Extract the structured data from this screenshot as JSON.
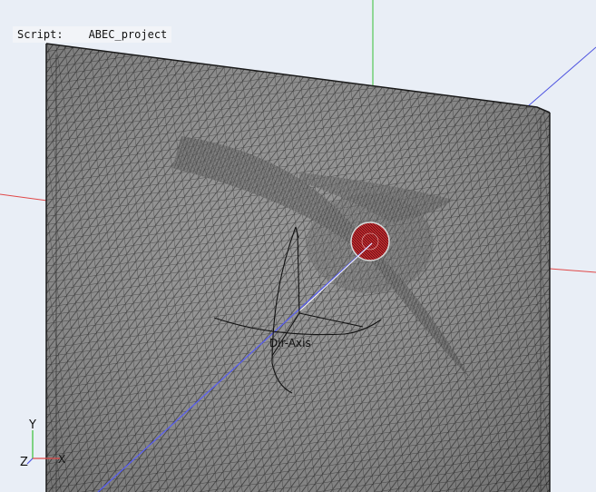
{
  "script": {
    "label": "Script:",
    "value": "ABEC_project"
  },
  "origin_axes": {
    "x": "X",
    "y": "Y",
    "z": "Z"
  },
  "triad_caption": "Dir-Axis",
  "colors": {
    "background": "#e9eef6",
    "mesh_fill": "#8c8c8c",
    "mesh_lines": "#262626",
    "source_fill": "#c0282d",
    "x_axis": "#e04848",
    "y_axis": "#36c036",
    "z_axis": "#4f55e0"
  }
}
